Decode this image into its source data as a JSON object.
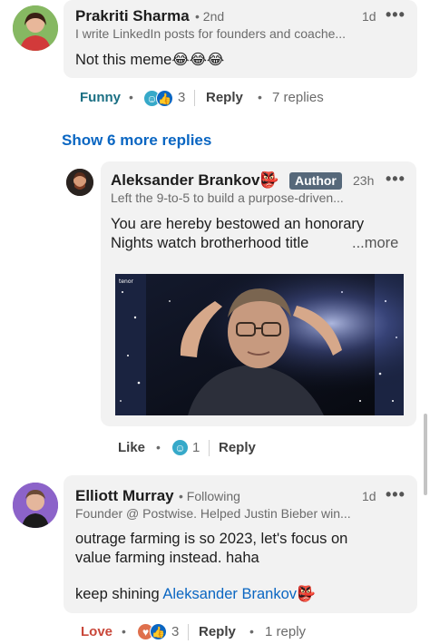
{
  "comment1": {
    "author": "Prakriti Sharma",
    "degree": "• 2nd",
    "time": "1d",
    "more": "•••",
    "headline": "I write LinkedIn posts for founders and coache...",
    "text": "Not this meme",
    "emojis": "😂😂😂",
    "reaction_label": "Funny",
    "reaction_count": "3",
    "reply_label": "Reply",
    "replies": "7 replies",
    "reaction_icons": [
      "funny-icon",
      "like-icon"
    ]
  },
  "show_more": "Show 6 more replies",
  "reply1": {
    "author": "Aleksander Brankov",
    "author_emoji": "👺",
    "badge": "Author",
    "time": "23h",
    "more": "•••",
    "headline": "Left the 9-to-5 to build a purpose-driven...",
    "text_line1": "You are hereby bestowed an honorary",
    "text_line2": "Nights watch brotherhood title",
    "more_link": "...more",
    "gif_watermark": "tenor",
    "like_label": "Like",
    "reaction_count": "1",
    "reply_label": "Reply",
    "reaction_icons": [
      "funny-icon"
    ]
  },
  "comment2": {
    "author": "Elliott Murray",
    "following": "• Following",
    "time": "1d",
    "more": "•••",
    "headline": "Founder @ Postwise. Helped Justin Bieber win...",
    "text_line1": "outrage farming is so 2023, let's focus on",
    "text_line2": "value farming instead. haha",
    "text_line3": "keep shining",
    "mention": "Aleksander Brankov",
    "mention_emoji": "👺",
    "reaction_label": "Love",
    "reaction_count": "3",
    "reply_label": "Reply",
    "replies": "1 reply",
    "reaction_icons": [
      "love-icon",
      "like-icon"
    ]
  },
  "colors": {
    "link": "#0a66c2",
    "funny": "#1a6f83",
    "love": "#c9473a",
    "bubble": "#f2f2f2",
    "author_badge": "#56687a"
  }
}
